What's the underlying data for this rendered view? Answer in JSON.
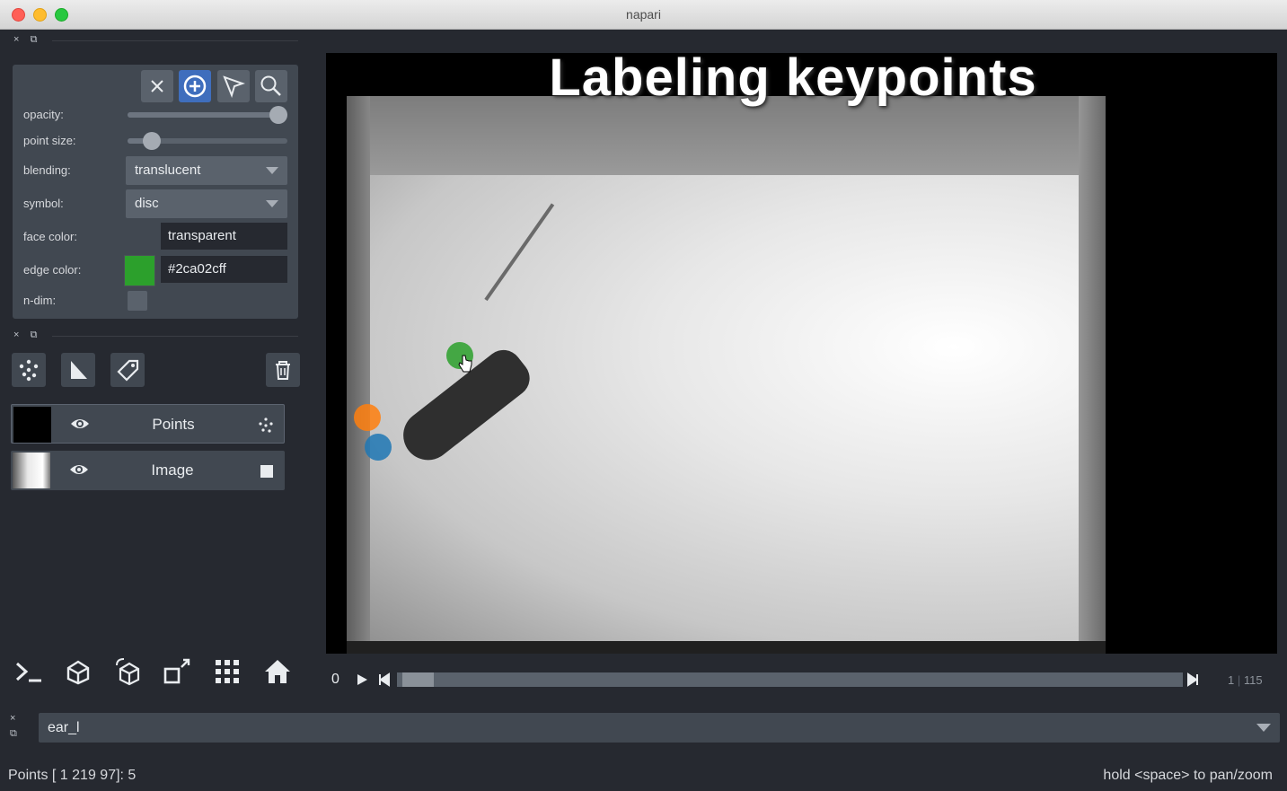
{
  "window": {
    "title": "napari"
  },
  "dock_icons": {
    "close": "×",
    "float": "⧉"
  },
  "controls": {
    "tools": [
      {
        "name": "delete-selected",
        "glyph": "✕"
      },
      {
        "name": "add-points",
        "glyph": "⊕",
        "active": true
      },
      {
        "name": "select-points",
        "glyph": "arrow"
      },
      {
        "name": "pan-zoom",
        "glyph": "magnifier"
      }
    ],
    "opacity_label": "opacity:",
    "opacity_value": 1.0,
    "point_size_label": "point size:",
    "point_size_value": 0.15,
    "blending_label": "blending:",
    "blending_value": "translucent",
    "symbol_label": "symbol:",
    "symbol_value": "disc",
    "face_color_label": "face color:",
    "face_color_value": "transparent",
    "edge_color_label": "edge color:",
    "edge_color_value": "#2ca02cff",
    "edge_color_swatch": "#2ca02c",
    "ndim_label": "n-dim:"
  },
  "layers": [
    {
      "name": "Points",
      "type": "points",
      "selected": true,
      "visible": true
    },
    {
      "name": "Image",
      "type": "image",
      "selected": false,
      "visible": true
    }
  ],
  "canvas": {
    "overlay_title": "Labeling keypoints",
    "keypoint_colors": [
      "#2ca02c",
      "#ff7f0e",
      "#1f77b4"
    ]
  },
  "player": {
    "frame_label": "0",
    "current_frame": "1",
    "total_frames": "115",
    "position_fraction": 0.0
  },
  "label_selector": {
    "value": "ear_l"
  },
  "status": {
    "left": "Points [  1 219  97]: 5",
    "right": "hold <space> to pan/zoom"
  },
  "colors": {
    "background": "#262930",
    "panel": "#414851",
    "accent": "#3f6ebd"
  }
}
